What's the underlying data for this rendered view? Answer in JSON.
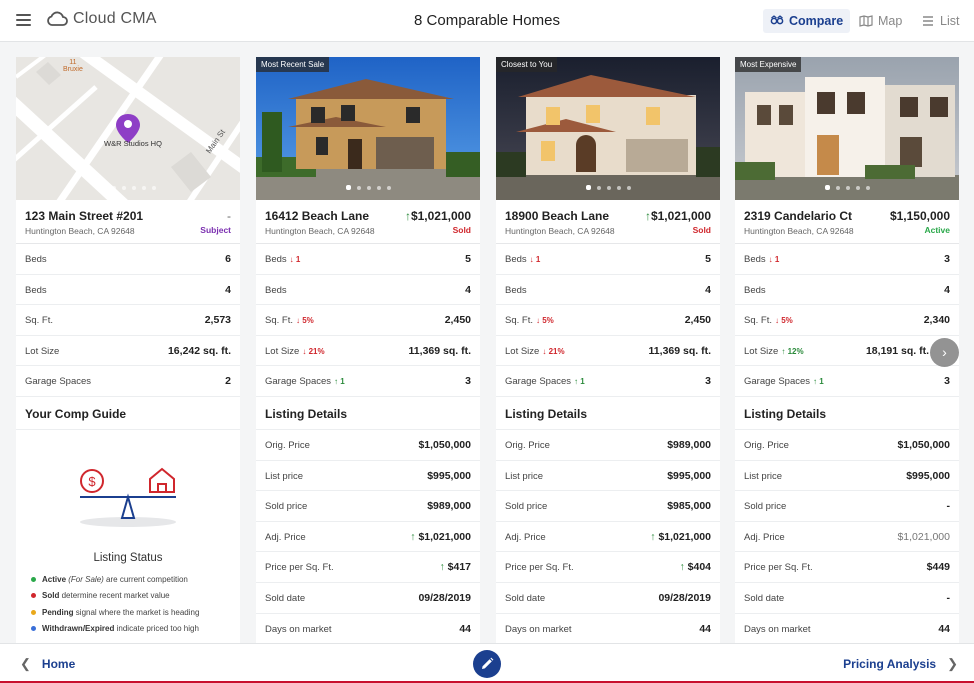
{
  "app": {
    "name": "Cloud CMA",
    "title": "8 Comparable Homes"
  },
  "views": {
    "compare": "Compare",
    "map": "Map",
    "list": "List"
  },
  "map": {
    "poi_number": "11",
    "poi_name": "Bruxie",
    "pin_label": "W&R Studios HQ",
    "street": "Main St"
  },
  "subject": {
    "address": "123 Main Street #201",
    "city": "Huntington Beach, CA 92648",
    "price": "-",
    "status": "Subject",
    "rows": [
      {
        "label": "Beds",
        "value": "6"
      },
      {
        "label": "Beds",
        "value": "4"
      },
      {
        "label": "Sq. Ft.",
        "value": "2,573"
      },
      {
        "label": "Lot Size",
        "value": "16,242 sq. ft."
      },
      {
        "label": "Garage Spaces",
        "value": "2"
      }
    ],
    "guide": {
      "title": "Your Comp Guide",
      "status_title": "Listing Status",
      "legend": [
        {
          "bold": "Active",
          "italic": "(For Sale)",
          "text": "are current competition",
          "color": "#2aa84a"
        },
        {
          "bold": "Sold",
          "italic": "",
          "text": "determine recent market value",
          "color": "#d0272d"
        },
        {
          "bold": "Pending",
          "italic": "",
          "text": "signal where the market is heading",
          "color": "#e9a81b"
        },
        {
          "bold": "Withdrawn/Expired",
          "italic": "",
          "text": "indicate priced too high",
          "color": "#3a6fd8"
        }
      ]
    }
  },
  "comps": [
    {
      "tag": "Most Recent Sale",
      "address": "16412 Beach Lane",
      "city": "Huntington Beach, CA 92648",
      "price": "$1,021,000",
      "status": "Sold",
      "rows": [
        {
          "label": "Beds",
          "delta": "1",
          "value": "5"
        },
        {
          "label": "Beds",
          "delta": "",
          "value": "4"
        },
        {
          "label": "Sq. Ft.",
          "delta": "5%",
          "value": "2,450"
        },
        {
          "label": "Lot Size",
          "delta": "21%",
          "value": "11,369 sq. ft."
        },
        {
          "label": "Garage Spaces",
          "delta": "1",
          "value": "3"
        }
      ],
      "details_title": "Listing Details",
      "details": [
        {
          "label": "Orig. Price",
          "value": "$1,050,000"
        },
        {
          "label": "List price",
          "value": "$995,000"
        },
        {
          "label": "Sold price",
          "value": "$989,000"
        },
        {
          "label": "Adj. Price",
          "value": "$1,021,000"
        },
        {
          "label": "Price per Sq. Ft.",
          "value": "$417"
        },
        {
          "label": "Sold date",
          "value": "09/28/2019"
        },
        {
          "label": "Days on market",
          "value": "44"
        }
      ]
    },
    {
      "tag": "Closest to You",
      "address": "18900 Beach Lane",
      "city": "Huntington Beach, CA 92648",
      "price": "$1,021,000",
      "status": "Sold",
      "rows": [
        {
          "label": "Beds",
          "delta": "1",
          "value": "5"
        },
        {
          "label": "Beds",
          "delta": "",
          "value": "4"
        },
        {
          "label": "Sq. Ft.",
          "delta": "5%",
          "value": "2,450"
        },
        {
          "label": "Lot Size",
          "delta": "21%",
          "value": "11,369 sq. ft."
        },
        {
          "label": "Garage Spaces",
          "delta": "1",
          "value": "3"
        }
      ],
      "details_title": "Listing Details",
      "details": [
        {
          "label": "Orig. Price",
          "value": "$989,000"
        },
        {
          "label": "List price",
          "value": "$995,000"
        },
        {
          "label": "Sold price",
          "value": "$985,000"
        },
        {
          "label": "Adj. Price",
          "value": "$1,021,000"
        },
        {
          "label": "Price per Sq. Ft.",
          "value": "$404"
        },
        {
          "label": "Sold date",
          "value": "09/28/2019"
        },
        {
          "label": "Days on market",
          "value": "44"
        }
      ]
    },
    {
      "tag": "Most Expensive",
      "address": "2319 Candelario Ct",
      "city": "Huntington Beach, CA 92648",
      "price": "$1,150,000",
      "status": "Active",
      "rows": [
        {
          "label": "Beds",
          "delta": "1",
          "value": "3"
        },
        {
          "label": "Beds",
          "delta": "",
          "value": "4"
        },
        {
          "label": "Sq. Ft.",
          "delta": "5%",
          "value": "2,340"
        },
        {
          "label": "Lot Size",
          "delta": "12%",
          "value": "18,191 sq. ft."
        },
        {
          "label": "Garage Spaces",
          "delta": "1",
          "value": "3"
        }
      ],
      "details_title": "Listing Details",
      "details": [
        {
          "label": "Orig. Price",
          "value": "$1,050,000"
        },
        {
          "label": "List price",
          "value": "$995,000"
        },
        {
          "label": "Sold price",
          "value": "-"
        },
        {
          "label": "Adj. Price",
          "value": "$1,021,000"
        },
        {
          "label": "Price per Sq. Ft.",
          "value": "$449"
        },
        {
          "label": "Sold date",
          "value": "-"
        },
        {
          "label": "Days on market",
          "value": "44"
        }
      ]
    }
  ],
  "bottom": {
    "back": "Home",
    "next": "Pricing Analysis"
  },
  "colors": {
    "brand": "#1b3f8f",
    "sold": "#d0272d",
    "active": "#2aa84a",
    "subject": "#7b2fb0",
    "accent_line": "#c8102e"
  }
}
